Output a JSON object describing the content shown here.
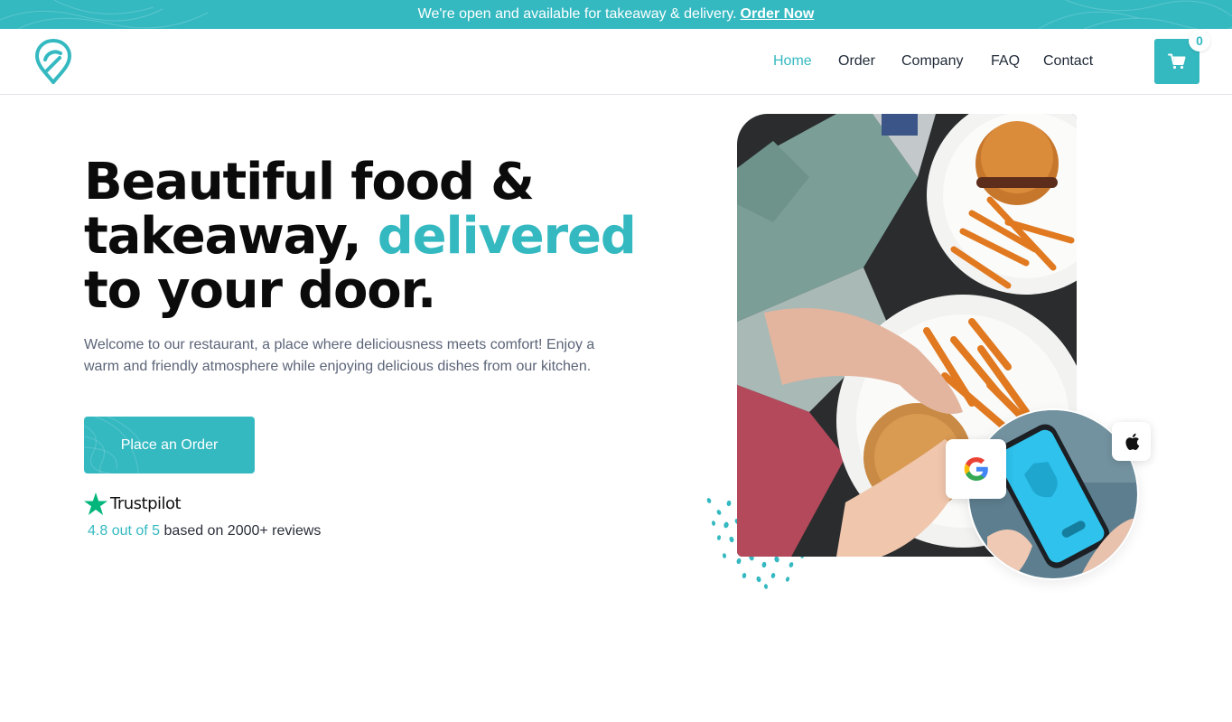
{
  "announcement": {
    "message": "We're open and available for takeaway & delivery.",
    "link_label": "Order Now"
  },
  "header": {
    "logo_icon": "location-pin-icon",
    "nav": [
      {
        "label": "Home",
        "active": true
      },
      {
        "label": "Order",
        "active": false
      },
      {
        "label": "Company",
        "active": false
      },
      {
        "label": "FAQ",
        "active": false
      },
      {
        "label": "Contact",
        "active": false
      }
    ],
    "cart": {
      "icon": "cart-icon",
      "count": "0"
    }
  },
  "hero": {
    "headline_line1": "Beautiful food &",
    "headline_line2_prefix": "takeaway, ",
    "headline_accent": "delivered",
    "headline_line3": "to your door.",
    "intro": "Welcome to our restaurant, a place where deliciousness meets comfort! Enjoy a warm and friendly atmosphere while enjoying delicious dishes from our kitchen.",
    "cta_label": "Place an Order",
    "trustpilot": {
      "brand": "Trustpilot",
      "score": "4.8 out of 5",
      "suffix": "based on 2000+ reviews"
    },
    "images": {
      "photo": "food-photo-burger-fries",
      "phone": "phone-app-photo",
      "google_icon": "google-icon",
      "apple_icon": "apple-icon"
    }
  },
  "colors": {
    "accent": "#35b9c1",
    "heading": "#0b0b0b",
    "body_text": "#5b6478",
    "nav_text": "#1f2937",
    "trustpilot_green": "#00b67a"
  }
}
